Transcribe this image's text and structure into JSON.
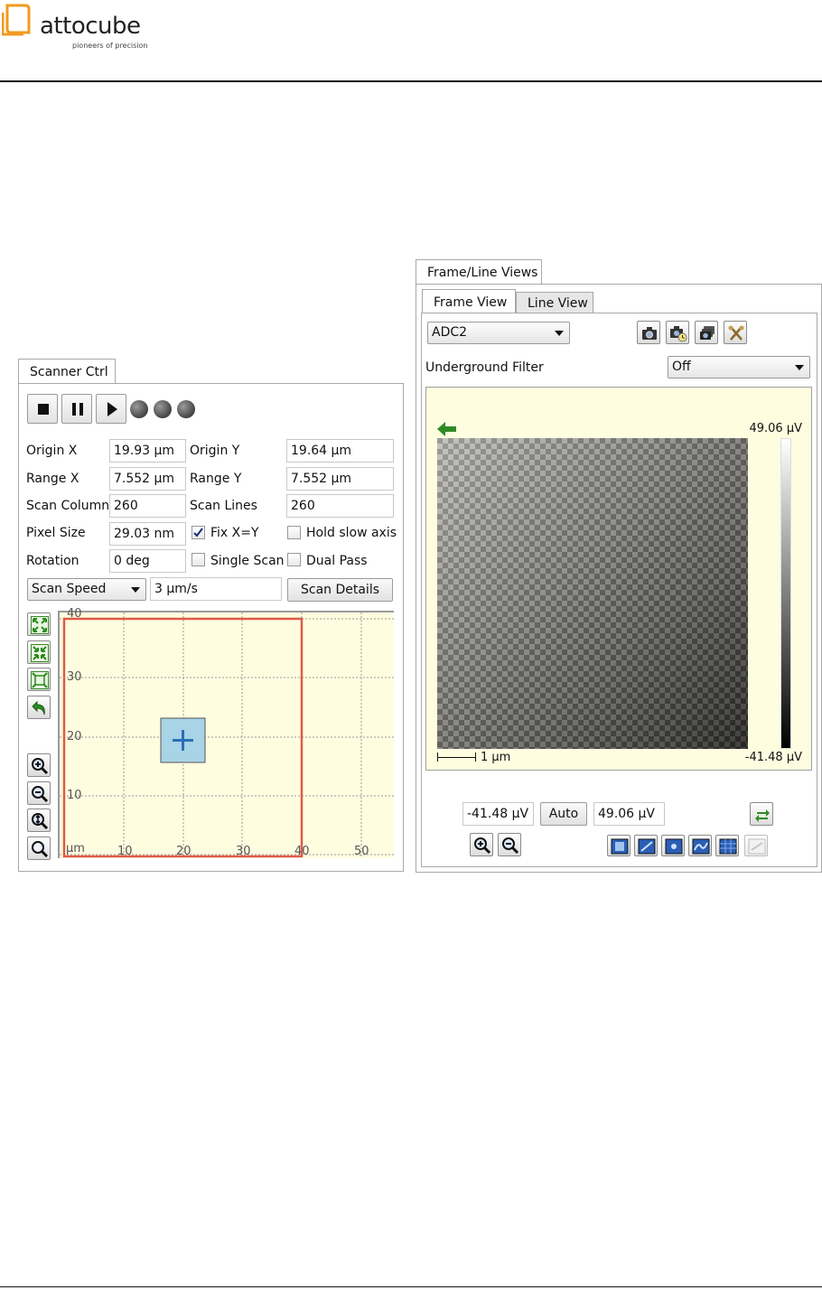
{
  "header": {
    "brand": "attocube",
    "tagline": "pioneers of precision"
  },
  "scanner": {
    "tab": "Scanner Ctrl",
    "fields": {
      "origin_x_label": "Origin X",
      "origin_x": "19.93 µm",
      "origin_y_label": "Origin Y",
      "origin_y": "19.64 µm",
      "range_x_label": "Range X",
      "range_x": "7.552 µm",
      "range_y_label": "Range Y",
      "range_y": "7.552 µm",
      "scan_columns_label": "Scan Columns",
      "scan_columns": "260",
      "scan_lines_label": "Scan Lines",
      "scan_lines": "260",
      "pixel_size_label": "Pixel Size",
      "pixel_size": "29.03 nm",
      "rotation_label": "Rotation",
      "rotation": "0 deg"
    },
    "checks": {
      "fix_xy": {
        "label": "Fix  X=Y",
        "checked": true
      },
      "hold_slow_axis": {
        "label": "Hold slow axis",
        "checked": false
      },
      "single_scan": {
        "label": "Single Scan",
        "checked": false
      },
      "dual_pass": {
        "label": "Dual Pass",
        "checked": false
      }
    },
    "speed_mode": "Scan Speed",
    "speed_value": "3 µm/s",
    "details_button": "Scan Details",
    "plot": {
      "unit": "µm",
      "x_ticks": [
        "10",
        "20",
        "30",
        "40",
        "50"
      ],
      "y_ticks": [
        "40",
        "30",
        "20",
        "10"
      ]
    },
    "colors": {
      "plot_bg": "#fffde0",
      "range_box": "#e05a4a",
      "scan_area": "#a9d3e6"
    }
  },
  "views": {
    "outer_tab": "Frame/Line Views",
    "tabs": [
      "Frame View",
      "Line View"
    ],
    "channel": "ADC2",
    "filter_label": "Underground Filter",
    "filter_value": "Off",
    "colorbar_max": "49.06 µV",
    "colorbar_min": "-41.48 µV",
    "scalebar": "1 µm",
    "range_min": "-41.48 µV",
    "auto_button": "Auto",
    "range_max": "49.06 µV",
    "icons": {
      "snapshot": "camera-icon",
      "timed_snapshot": "camera-timer-icon",
      "multi_snapshot": "camera-stack-icon",
      "settings": "tools-icon"
    }
  }
}
